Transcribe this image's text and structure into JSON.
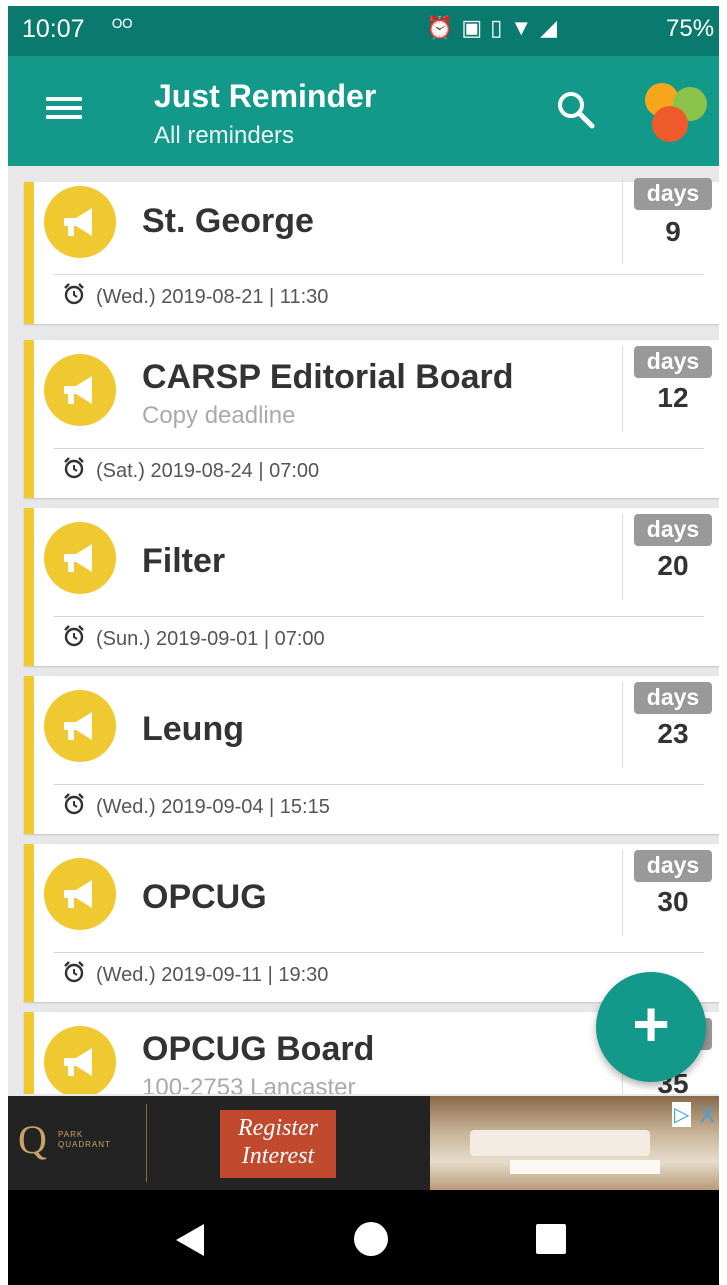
{
  "status_bar": {
    "time": "10:07",
    "voicemail_icon": "voicemail-icon",
    "icons": [
      "alarm-icon",
      "cast-icon",
      "vibrate-icon",
      "wifi-icon",
      "signal-icon"
    ],
    "battery": "75%"
  },
  "app_bar": {
    "title": "Just Reminder",
    "subtitle": "All reminders",
    "menu_icon": "hamburger-menu-icon",
    "search_icon": "search-icon",
    "logo_icon": "app-logo-icon"
  },
  "reminders": [
    {
      "title": "St. George",
      "subtitle": "",
      "days_label": "days",
      "days": "9",
      "date": "(Wed.) 2019-08-21 | 11:30"
    },
    {
      "title": "CARSP Editorial Board",
      "subtitle": "Copy deadline",
      "days_label": "days",
      "days": "12",
      "date": "(Sat.) 2019-08-24 | 07:00"
    },
    {
      "title": "Filter",
      "subtitle": "",
      "days_label": "days",
      "days": "20",
      "date": "(Sun.) 2019-09-01 | 07:00"
    },
    {
      "title": "Leung",
      "subtitle": "",
      "days_label": "days",
      "days": "23",
      "date": "(Wed.) 2019-09-04 | 15:15"
    },
    {
      "title": "OPCUG",
      "subtitle": "",
      "days_label": "days",
      "days": "30",
      "date": "(Wed.) 2019-09-11 | 19:30"
    },
    {
      "title": "OPCUG Board",
      "subtitle": "100-2753 Lancaster",
      "days_label": "days",
      "days": "35",
      "date": ""
    }
  ],
  "fab": {
    "label": "+"
  },
  "ad": {
    "brand_mark": "Q",
    "brand_text": "PARK QUADRANT",
    "cta": "Register Interest",
    "adchoices_icon": "▷",
    "close_icon": "X"
  },
  "nav_bar": {
    "back_icon": "back-triangle-icon",
    "home_icon": "home-circle-icon",
    "recents_icon": "recents-square-icon"
  },
  "colors": {
    "status_bar": "#0b7a6e",
    "app_bar": "#12998a",
    "accent_yellow": "#f0c830",
    "days_badge": "#999999"
  }
}
